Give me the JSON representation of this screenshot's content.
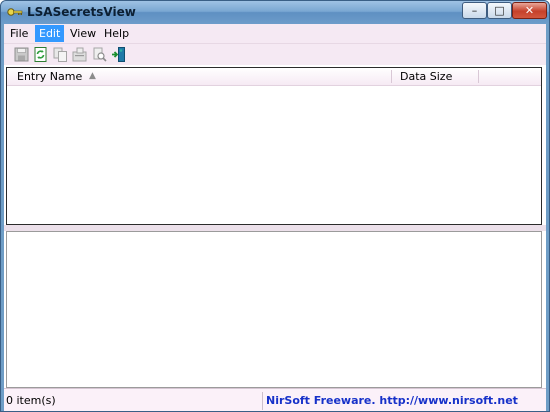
{
  "window": {
    "title": "LSASecretsView"
  },
  "titlebar_buttons": {
    "minimize": "–",
    "maximize": "□",
    "close": "✕"
  },
  "menu": [
    {
      "label": "File"
    },
    {
      "label": "Edit"
    },
    {
      "label": "View"
    },
    {
      "label": "Help"
    }
  ],
  "toolbar": {
    "buttons": [
      {
        "icon": "save-icon"
      },
      {
        "icon": "refresh-icon"
      },
      {
        "icon": "copy-icon"
      },
      {
        "icon": "properties-icon"
      },
      {
        "icon": "find-icon"
      },
      {
        "icon": "exit-icon"
      }
    ]
  },
  "list": {
    "columns": [
      {
        "label": "Entry Name"
      },
      {
        "label": "Data Size"
      }
    ]
  },
  "status": {
    "items": "0 item(s)",
    "link": "NirSoft Freeware.  http://www.nirsoft.net"
  }
}
